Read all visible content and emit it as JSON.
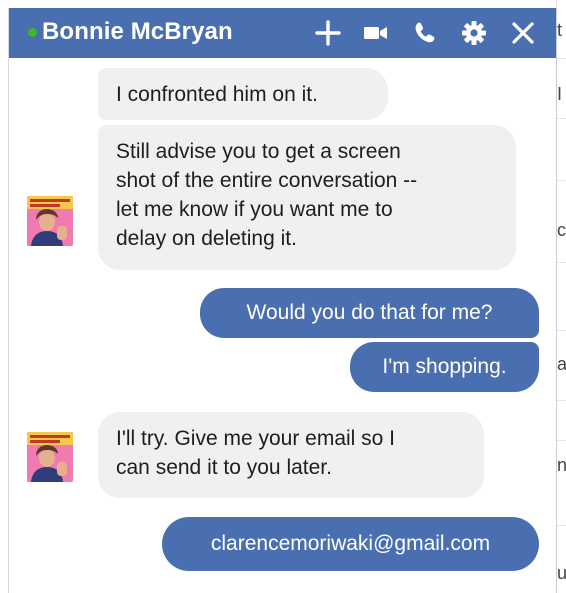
{
  "chat": {
    "contact_name": "Bonnie McBryan",
    "online": true,
    "accent_color": "#4a6fb0",
    "online_color": "#42b72a"
  },
  "toolbar": {
    "icons": [
      "plus-icon",
      "video-camera-icon",
      "phone-icon",
      "gear-icon",
      "close-icon"
    ]
  },
  "messages": [
    {
      "from": "contact",
      "lines": [
        "I confronted him on it."
      ]
    },
    {
      "from": "contact",
      "lines": [
        "Still advise you to get a screen",
        "shot of the entire conversation --",
        "let me know if you want me to",
        "delay on deleting it."
      ]
    },
    {
      "from": "me",
      "lines": [
        "Would you do that for me?"
      ]
    },
    {
      "from": "me",
      "lines": [
        "I'm shopping."
      ]
    },
    {
      "from": "contact",
      "lines": [
        "I'll try. Give me your email so I",
        "can send it to you later."
      ]
    },
    {
      "from": "me",
      "lines": [
        "clarencemoriwaki@gmail.com"
      ]
    }
  ],
  "background": {
    "edge_chars": [
      "t",
      "I",
      "c",
      "a",
      "n",
      "u"
    ]
  }
}
